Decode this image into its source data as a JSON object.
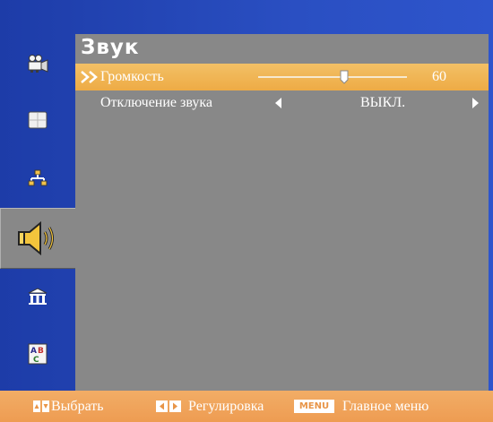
{
  "sidebar": {
    "items": [
      {
        "icon": "camera-icon",
        "active": false
      },
      {
        "icon": "picture-icon",
        "active": false
      },
      {
        "icon": "network-icon",
        "active": false
      },
      {
        "icon": "speaker-icon",
        "active": true
      },
      {
        "icon": "building-icon",
        "active": false
      },
      {
        "icon": "language-icon",
        "active": false
      }
    ]
  },
  "panel": {
    "title": "Звук",
    "rows": [
      {
        "label": "Громкость",
        "value": "60",
        "slider_fraction": 0.58,
        "selected": true
      },
      {
        "label": "Отключение звука",
        "value": "ВЫКЛ.",
        "selected": false
      }
    ]
  },
  "bottom_bar": {
    "select_label": "Выбрать",
    "adjust_label": "Регулировка",
    "menu_key_label": "MENU",
    "main_menu_label": "Главное меню"
  },
  "colors": {
    "background": "#2446b4",
    "panel": "#888888",
    "highlight": "#eeab45",
    "bottom_bar": "#ee9c52",
    "text": "#ffffff"
  }
}
